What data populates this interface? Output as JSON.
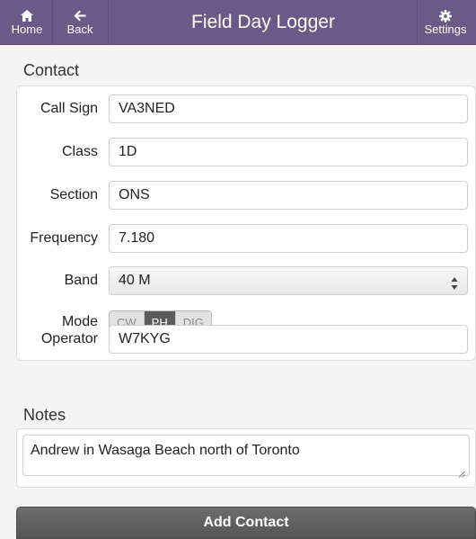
{
  "header": {
    "home_label": "Home",
    "back_label": "Back",
    "title": "Field Day Logger",
    "settings_label": "Settings",
    "home_icon": "home-icon",
    "back_icon": "arrow-left-icon",
    "settings_icon": "gear-icon",
    "bar_color": "#6a5a87"
  },
  "contact": {
    "section_label": "Contact",
    "fields": {
      "call_sign": {
        "label": "Call Sign",
        "value": "VA3NED"
      },
      "class": {
        "label": "Class",
        "value": "1D"
      },
      "section": {
        "label": "Section",
        "value": "ONS"
      },
      "frequency": {
        "label": "Frequency",
        "value": "7.180"
      },
      "band": {
        "label": "Band",
        "value": "40 M"
      },
      "operator": {
        "label": "Operator",
        "value": "W7KYG"
      }
    },
    "mode": {
      "label": "Mode",
      "options": [
        "CW",
        "PH",
        "DIG"
      ],
      "selected": "PH"
    }
  },
  "notes": {
    "section_label": "Notes",
    "value": "Andrew in Wasaga Beach north of Toronto"
  },
  "actions": {
    "add_contact_label": "Add Contact"
  }
}
